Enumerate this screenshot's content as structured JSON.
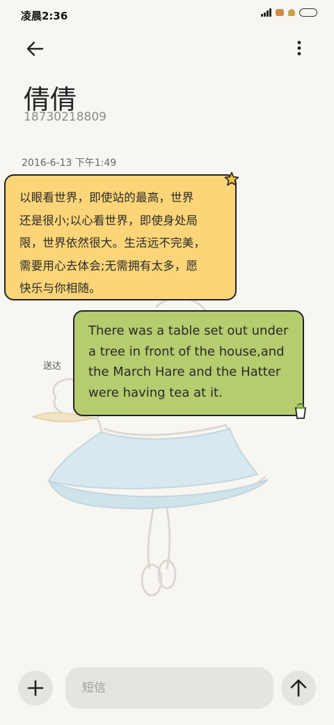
{
  "status_bar": {
    "time": "凌晨2:36"
  },
  "header": {
    "contact_name": "倩倩",
    "contact_phone": "18730218809"
  },
  "conversation": {
    "timestamp": "2016-6-13 下午1:49",
    "incoming": {
      "lines": [
        "以眼看世界，即使站的最高，世界",
        "还是很小;以心看世界，即使身处局",
        "限，世界依然很大。生活远不完美，",
        "需要用心去体会;无需拥有太多，愿",
        "快乐与你相随。"
      ]
    },
    "outgoing": {
      "lines": [
        "There was a table set out under",
        "a tree in front of the house,and",
        "the March Hare and the Hatter",
        "were having tea at it."
      ],
      "status": "送达"
    }
  },
  "composer": {
    "placeholder": "短信"
  },
  "colors": {
    "background": "#f8f6f1",
    "incoming_bubble": "#fbd578",
    "outgoing_bubble": "#b5cc6f",
    "button_bg": "#e6e4df"
  },
  "icons": [
    "back-arrow-icon",
    "more-vertical-icon",
    "star-icon",
    "cup-icon",
    "plus-icon",
    "send-arrow-icon"
  ]
}
